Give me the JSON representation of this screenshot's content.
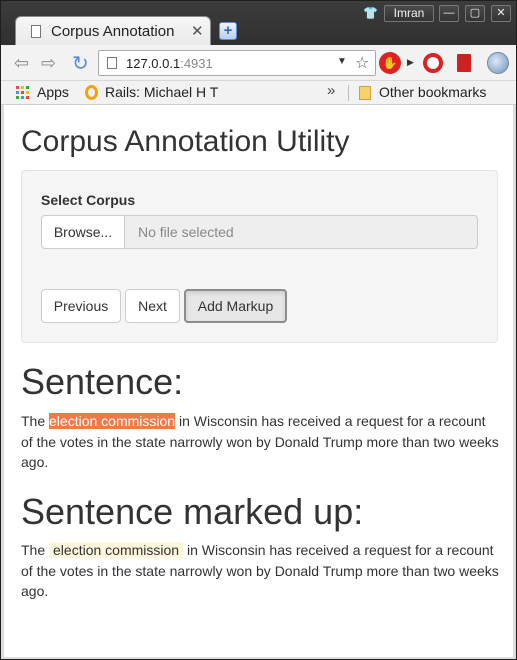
{
  "browser": {
    "tab_title": "Corpus Annotation",
    "tab_close": "✕",
    "user_name": "Imran",
    "url_host": "127.0.0.1",
    "url_port": ":4931",
    "bookmarks": {
      "apps": "Apps",
      "rails": "Rails: Michael H T",
      "overflow": "»",
      "other": "Other bookmarks"
    }
  },
  "page": {
    "title": "Corpus Annotation Utility",
    "select_corpus_label": "Select Corpus",
    "browse_label": "Browse...",
    "file_placeholder": "No file selected",
    "buttons": {
      "previous": "Previous",
      "next": "Next",
      "add_markup": "Add Markup"
    },
    "sentence_heading": "Sentence:",
    "sentence": {
      "before": "The ",
      "highlight": "election commission",
      "after": " in Wisconsin has received a request for a recount of the votes in the state narrowly won by Donald Trump more than two weeks ago."
    },
    "marked_heading": "Sentence marked up:",
    "marked": {
      "before": "The ",
      "highlight": "election commission",
      "after": " in Wisconsin has received a request for a recount of the votes in the state narrowly won by Donald Trump more than two weeks ago."
    }
  },
  "colors": {
    "highlight_red": "#f0794b",
    "highlight_cream": "#fdf5dc",
    "stop_extension": "#dd2222"
  }
}
